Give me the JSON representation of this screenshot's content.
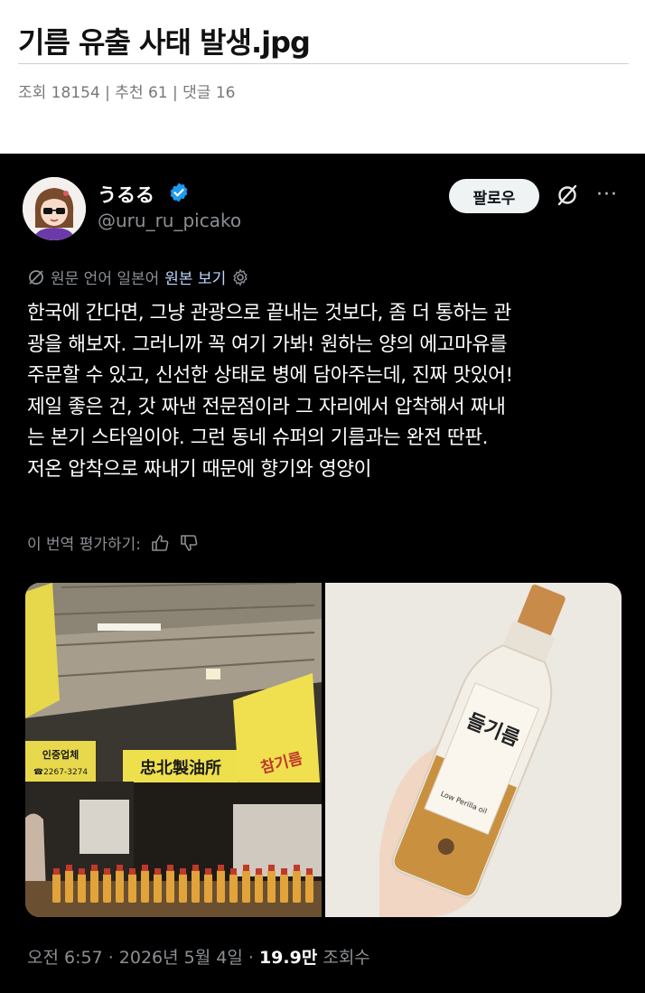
{
  "post": {
    "title": "기름 유출 사태 발생.jpg",
    "meta": "조회 18154 | 추천 61 | 댓글 16"
  },
  "tweet": {
    "display_name": "うるる",
    "handle": "@uru_ru_picako",
    "follow_label": "팔로우",
    "translation_note": "원문 언어 일본어",
    "show_original_label": "원본 보기",
    "body_lines": [
      "한국에 간다면, 그냥 관광으로 끝내는 것보다, 좀 더 통하는 관",
      "광을 해보자. 그러니까 꼭 여기 가봐! 원하는 양의 에고마유를",
      "주문할 수 있고, 신선한 상태로 병에 담아주는데, 진짜 맛있어!",
      "제일 좋은 건, 갓 짜낸 전문점이라 그 자리에서 압착해서 짜내",
      "는 본기 스타일이야. 그런 동네 슈퍼의 기름과는 완전 딴판.",
      "저온 압착으로 짜내기 때문에 향기와 영양이"
    ],
    "rate_translation_label": "이 번역 평가하기:",
    "photo_signs": {
      "shop_name": "忠北製油所",
      "left_sign": "인중업체",
      "phone": "☎2267-3274",
      "right_sign": "참기름",
      "bottle_label": "들기름",
      "bottle_sub": "Low Perilla oil"
    },
    "time_date": "오전 6:57 · 2026년 5월 4일 · ",
    "views": "19.9만",
    "views_label": " 조회수"
  },
  "icons": {
    "verified": "verified-badge-icon",
    "grok": "grok-icon",
    "more": "more-icon",
    "translate": "translate-icon",
    "settings": "gear-icon",
    "thumbs_up": "thumbs-up-icon",
    "thumbs_down": "thumbs-down-icon"
  },
  "colors": {
    "verified_blue": "#1d9bf0",
    "tweet_background": "#000000",
    "muted_text": "#8b8f94"
  }
}
